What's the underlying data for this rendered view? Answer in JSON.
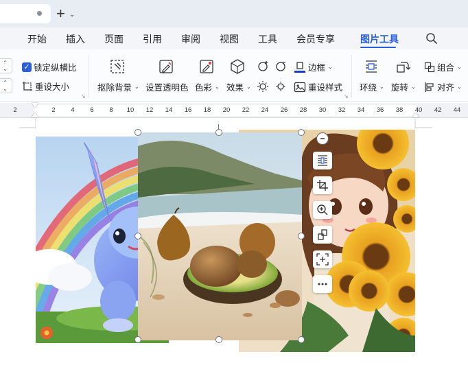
{
  "tabstrip": {
    "new_tab": "+",
    "new_tab_caret": "⌄"
  },
  "menu": {
    "items": [
      "开始",
      "插入",
      "页面",
      "引用",
      "审阅",
      "视图",
      "工具",
      "会员专享",
      "图片工具"
    ],
    "active": "图片工具"
  },
  "ribbon": {
    "lock_ratio": "锁定纵横比",
    "reset_size": "重设大小",
    "remove_bg": "抠除背景",
    "set_transparent": "设置透明色",
    "color": "色彩",
    "effects": "效果",
    "border": "边框",
    "reset_style": "重设样式",
    "wrap": "环绕",
    "rotate": "旋转",
    "group": "组合",
    "align": "对齐",
    "caret": "⌄"
  },
  "ruler": {
    "labels": [
      "2",
      "2",
      "4",
      "6",
      "8",
      "10",
      "12",
      "14",
      "16",
      "18",
      "20",
      "22",
      "24",
      "26",
      "28",
      "30",
      "32",
      "34",
      "36",
      "38",
      "40",
      "42",
      "44"
    ]
  },
  "images": {
    "left": "bunny-rainbow-picture",
    "center": "avocado-beach-picture",
    "right": "girl-sunflowers-picture"
  },
  "colors": {
    "accent": "#2a5fd8",
    "tabstrip": "#e8ecf3",
    "menubar": "#f3f5f9"
  }
}
